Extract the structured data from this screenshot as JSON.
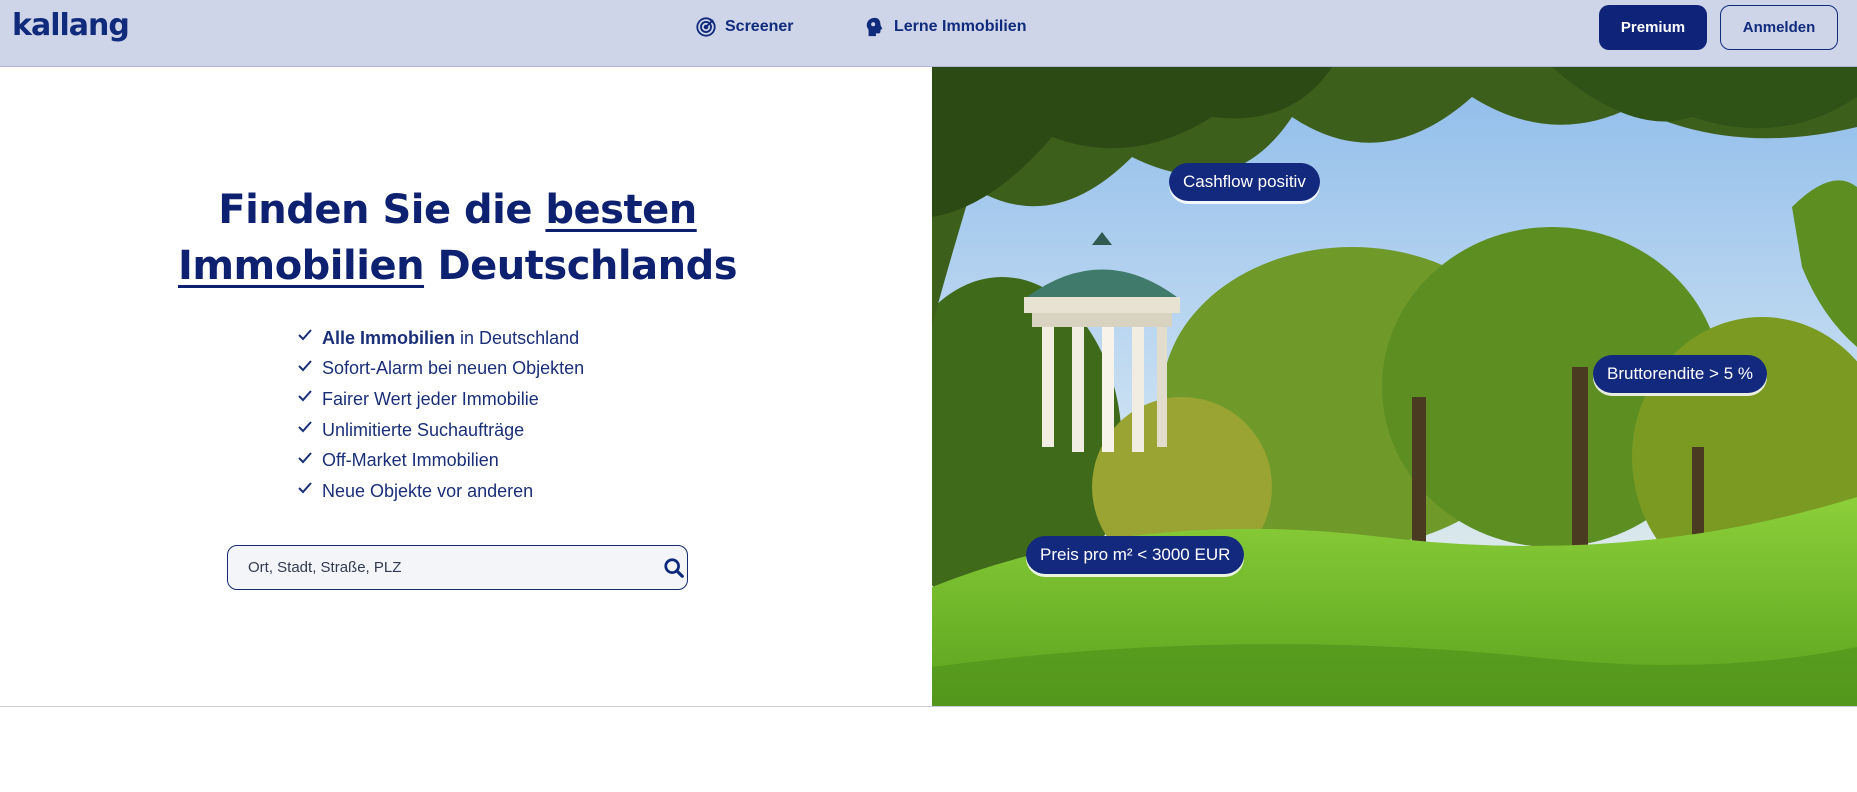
{
  "header": {
    "logo": "kallang",
    "nav": [
      {
        "label": "Screener",
        "icon": "target-icon"
      },
      {
        "label": "Lerne Immobilien",
        "icon": "brain-icon"
      }
    ],
    "premium_label": "Premium",
    "login_label": "Anmelden"
  },
  "hero": {
    "headline_part1": "Finden Sie die ",
    "headline_link1": "besten",
    "headline_link2": "Immobilien",
    "headline_part2": " Deutschlands",
    "features": [
      {
        "bold": "Alle Immobilien",
        "text": "in Deutschland"
      },
      {
        "bold": "",
        "text": "Sofort-Alarm bei neuen Objekten"
      },
      {
        "bold": "",
        "text": "Fairer Wert jeder Immobilie"
      },
      {
        "bold": "",
        "text": "Unlimitierte Suchaufträge"
      },
      {
        "bold": "",
        "text": "Off-Market Immobilien"
      },
      {
        "bold": "",
        "text": "Neue Objekte vor anderen"
      }
    ],
    "search": {
      "placeholder": "Ort, Stadt, Straße, PLZ",
      "value": ""
    }
  },
  "image_badges": {
    "cashflow": "Cashflow positiv",
    "rendite": "Bruttorendite > 5 %",
    "preis": "Preis pro m² < 3000 EUR"
  },
  "colors": {
    "brand": "#0f2478",
    "header_bg": "#cfd5e8",
    "badge_bg": "#13297e"
  }
}
